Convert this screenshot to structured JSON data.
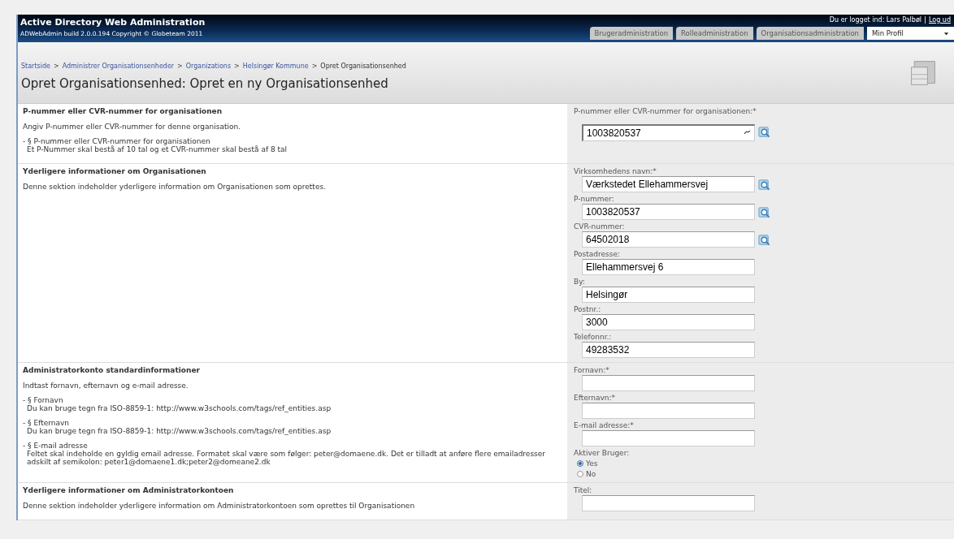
{
  "header": {
    "title": "Active Directory Web Administration",
    "subtitle": "ADWebAdmin build 2.0.0.194 Copyright © Globeteam 2011",
    "login_text": "Du er logget ind: Lars Palbøl",
    "logout_link": "Log ud"
  },
  "tabs": [
    {
      "label": "Brugeradministration",
      "selected": false,
      "dropdown": false
    },
    {
      "label": "Rolleadministration",
      "selected": false,
      "dropdown": false
    },
    {
      "label": "Organisationsadministration",
      "selected": false,
      "dropdown": false
    },
    {
      "label": "Min Profil",
      "selected": true,
      "dropdown": true
    }
  ],
  "breadcrumb_separator": ">",
  "breadcrumb": [
    {
      "label": "Startside",
      "link": true
    },
    {
      "label": "Administrer Organisationsenheder",
      "link": true
    },
    {
      "label": "Organizations",
      "link": true
    },
    {
      "label": "Helsingør Kommune",
      "link": true
    },
    {
      "label": "Opret Organisationsenhed",
      "link": false
    }
  ],
  "page_title": "Opret Organisationsenhed: Opret en ny Organisationsenhed",
  "sections": [
    {
      "title": "P-nummer eller CVR-nummer for organisationen",
      "description": "Angiv P-nummer eller CVR-nummer for denne organisation.",
      "notes": [
        {
          "heading": "- § P-nummer eller CVR-nummer for organisationen",
          "text": "Et P-Nummer skal bestå af 10 tal og et CVR-nummer skal bestå af 8 tal"
        }
      ],
      "fields": [
        {
          "kind": "input",
          "label": "P-nummer eller CVR-nummer for organisationen:*",
          "value": "1003820537",
          "lookup": true,
          "autocomplete": true
        }
      ]
    },
    {
      "title": "Yderligere informationer om Organisationen",
      "description": "Denne sektion indeholder yderligere information om Organisationen som oprettes.",
      "fields": [
        {
          "kind": "input",
          "label": "Virksomhedens navn:*",
          "value": "Værkstedet Ellehammersvej",
          "lookup": true,
          "autocomplete": false
        },
        {
          "kind": "input",
          "label": "P-nummer:",
          "value": "1003820537",
          "lookup": true,
          "autocomplete": false
        },
        {
          "kind": "input",
          "label": "CVR-nummer:",
          "value": "64502018",
          "lookup": true,
          "autocomplete": false
        },
        {
          "kind": "input",
          "label": "Postadresse:",
          "value": "Ellehammersvej 6",
          "lookup": false,
          "autocomplete": false
        },
        {
          "kind": "input",
          "label": "By:",
          "value": "Helsingør",
          "lookup": false,
          "autocomplete": false
        },
        {
          "kind": "input",
          "label": "Postnr.:",
          "value": "3000",
          "lookup": false,
          "autocomplete": false
        },
        {
          "kind": "input",
          "label": "Telefonnr.:",
          "value": "49283532",
          "lookup": false,
          "autocomplete": false
        }
      ]
    },
    {
      "title": "Administratorkonto standardinformationer",
      "description": "Indtast fornavn, efternavn og e-mail adresse.",
      "notes": [
        {
          "heading": "- § Fornavn",
          "text": "Du kan bruge tegn fra ISO-8859-1: http://www.w3schools.com/tags/ref_entities.asp"
        },
        {
          "heading": "- § Efternavn",
          "text": "Du kan bruge tegn fra ISO-8859-1: http://www.w3schools.com/tags/ref_entities.asp"
        },
        {
          "heading": "- § E-mail adresse",
          "text": "Feltet skal indeholde en gyldig email adresse. Formatet skal være som følger: peter@domaene.dk. Det er tilladt at anføre flere emailadresser adskilt af semikolon: peter1@domaene1.dk;peter2@domeane2.dk"
        }
      ],
      "fields": [
        {
          "kind": "input",
          "label": "Fornavn:*",
          "lookup": false,
          "autocomplete": false
        },
        {
          "kind": "input",
          "label": "Efternavn:*",
          "lookup": false,
          "autocomplete": false
        },
        {
          "kind": "input",
          "label": "E-mail adresse:*",
          "lookup": false,
          "autocomplete": false
        },
        {
          "kind": "radio",
          "label": "Aktiver Bruger:",
          "options": [
            {
              "label": "Yes",
              "selected": true
            },
            {
              "label": "No",
              "selected": false
            }
          ]
        }
      ]
    },
    {
      "title": "Yderligere informationer om Administratorkontoen",
      "description": "Denne sektion indeholder yderligere information om Administratorkontoen som oprettes til Organisationen",
      "fields": [
        {
          "kind": "input",
          "label": "Titel:",
          "lookup": false,
          "autocomplete": false
        }
      ]
    }
  ]
}
